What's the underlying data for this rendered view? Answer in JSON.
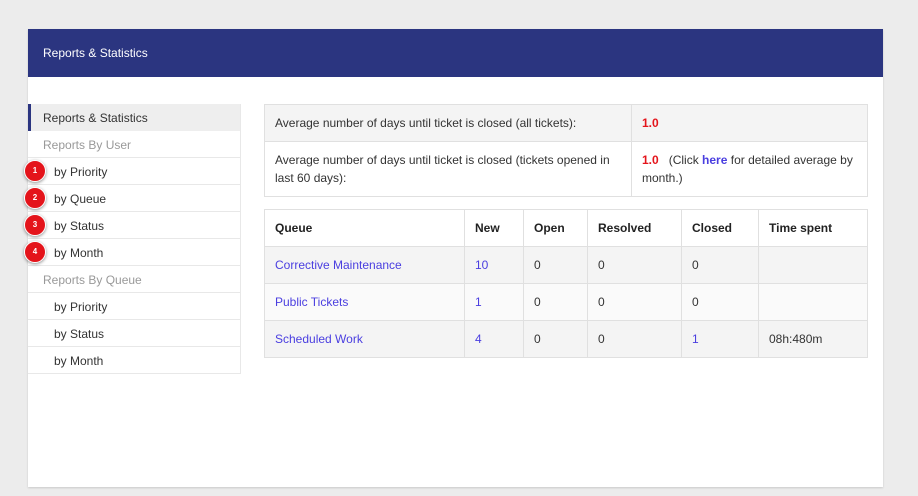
{
  "header": {
    "title": "Reports & Statistics"
  },
  "sidebar": {
    "items": [
      {
        "label": "Reports & Statistics"
      },
      {
        "label": "Reports By User"
      },
      {
        "label": "by Priority",
        "marker": "1"
      },
      {
        "label": "by Queue",
        "marker": "2"
      },
      {
        "label": "by Status",
        "marker": "3"
      },
      {
        "label": "by Month",
        "marker": "4"
      },
      {
        "label": "Reports By Queue"
      },
      {
        "label": "by Priority"
      },
      {
        "label": "by Status"
      },
      {
        "label": "by Month"
      }
    ]
  },
  "averages": {
    "row1": {
      "label": "Average number of days until ticket is closed (all tickets):",
      "value": "1.0"
    },
    "row2": {
      "label": "Average number of days until ticket is closed (tickets opened in last 60 days):",
      "value": "1.0",
      "note_prefix": "(Click",
      "link": "here",
      "note_suffix": "for detailed average by month.)"
    }
  },
  "queue_table": {
    "headers": [
      "Queue",
      "New",
      "Open",
      "Resolved",
      "Closed",
      "Time spent"
    ],
    "rows": [
      {
        "queue": "Corrective Maintenance",
        "new": "10",
        "open": "0",
        "resolved": "0",
        "closed": "0",
        "time": ""
      },
      {
        "queue": "Public Tickets",
        "new": "1",
        "open": "0",
        "resolved": "0",
        "closed": "0",
        "time": ""
      },
      {
        "queue": "Scheduled Work",
        "new": "4",
        "open": "0",
        "resolved": "0",
        "closed": "1",
        "time": "08h:480m"
      }
    ]
  },
  "colors": {
    "header_bg": "#2b3580",
    "link": "#4a3ee0",
    "value_red": "#e4141b",
    "marker_red": "#e4141b"
  }
}
